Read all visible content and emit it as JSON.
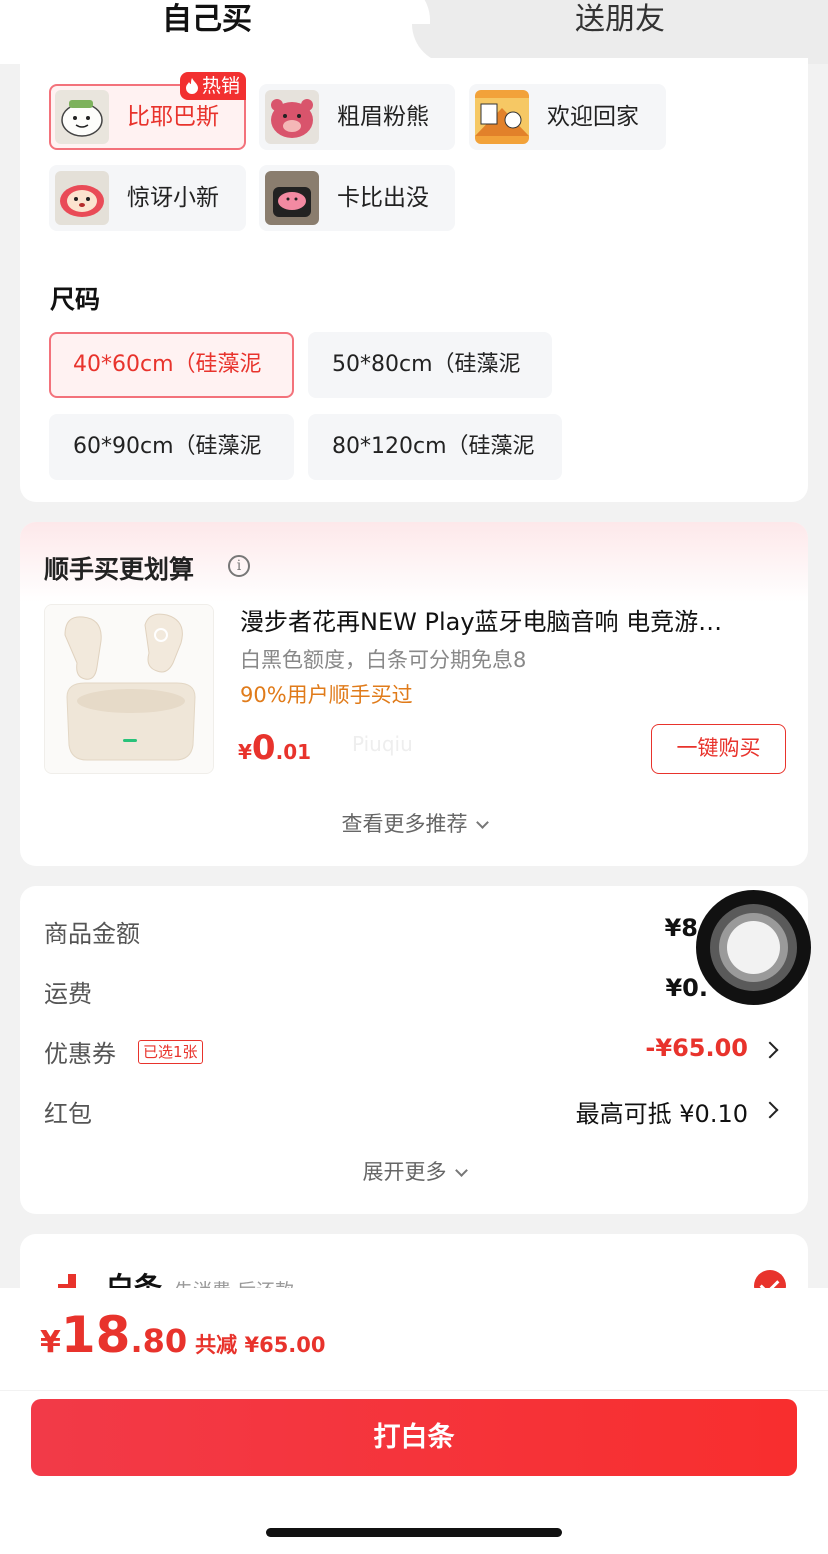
{
  "tabs": {
    "self": "自己买",
    "friend": "送朋友"
  },
  "styles": {
    "hot_badge": "热销",
    "items": [
      {
        "label": "比耶巴斯",
        "selected": true,
        "hot": true
      },
      {
        "label": "粗眉粉熊",
        "selected": false
      },
      {
        "label": "欢迎回家",
        "selected": false
      },
      {
        "label": "惊讶小新",
        "selected": false
      },
      {
        "label": "卡比出没",
        "selected": false
      }
    ]
  },
  "sizes": {
    "title": "尺码",
    "items": [
      {
        "label": "40*60cm（硅藻泥",
        "selected": true
      },
      {
        "label": "50*80cm（硅藻泥",
        "selected": false
      },
      {
        "label": "60*90cm（硅藻泥",
        "selected": false
      },
      {
        "label": "80*120cm（硅藻泥",
        "selected": false
      }
    ]
  },
  "addon": {
    "title": "顺手买更划算",
    "product": {
      "title": "漫步者花再NEW Play蓝牙电脑音响 电竞游…",
      "subtitle": "白黑色额度，白条可分期免息8",
      "rate": "90%用户顺手买过",
      "price_currency": "¥",
      "price_int": "0",
      "price_dec": ".01",
      "watermark": "Piuqiu",
      "buy_label": "一键购买"
    },
    "more_label": "查看更多推荐"
  },
  "price_detail": {
    "goods_label": "商品金额",
    "goods_value": "¥8",
    "shipping_label": "运费",
    "shipping_value": "¥0.",
    "coupon_label": "优惠券",
    "coupon_tag": "已选1张",
    "coupon_value": "-¥65.00",
    "redpacket_label": "红包",
    "redpacket_value": "最高可抵 ¥0.10",
    "expand_label": "展开更多"
  },
  "payment": {
    "name": "白条",
    "desc": "先消费 后还款"
  },
  "footer": {
    "currency": "¥",
    "total_int": "18",
    "total_dec": ".80",
    "saved": "共减 ¥65.00",
    "pay_label": "打白条"
  },
  "colors": {
    "accent": "#e8332c",
    "rate_orange": "#e07b1a",
    "bg": "#f2f2f2"
  }
}
